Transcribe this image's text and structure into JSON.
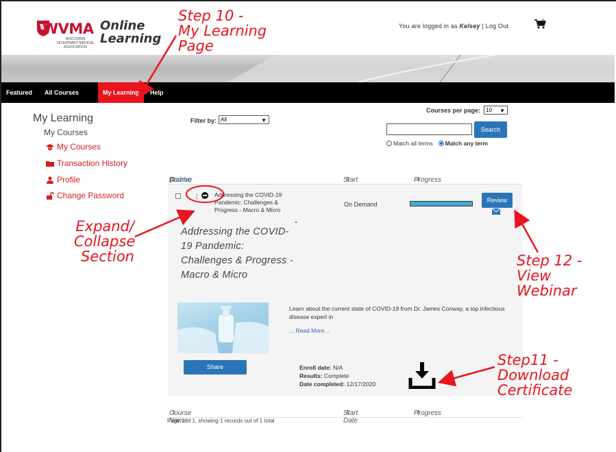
{
  "header": {
    "logo_text": "WVMA",
    "logo_subtext": "WISCONSIN VETERINARY MEDICAL ASSOCIATION",
    "logo_online": "Online",
    "logo_learning": "Learning",
    "login_prefix": "You are logged in as ",
    "username": "Kelsey",
    "logout": " | Log Out",
    "cart_count": "0"
  },
  "nav": {
    "items": [
      {
        "label": "Featured",
        "active": false
      },
      {
        "label": "All Courses",
        "active": false
      },
      {
        "label": "My Learning",
        "active": true
      },
      {
        "label": "Help",
        "active": false
      }
    ]
  },
  "sidebar": {
    "title": "My Learning",
    "subtitle": "My Courses",
    "links": [
      {
        "label": "My Courses",
        "icon": "graduation-cap-icon"
      },
      {
        "label": "Transaction History",
        "icon": "folder-icon"
      },
      {
        "label": "Profile",
        "icon": "user-icon"
      },
      {
        "label": "Change Password",
        "icon": "unlock-icon"
      }
    ]
  },
  "filters": {
    "filter_label": "Filter by:",
    "filter_value": "All",
    "per_page_label": "Courses per page:",
    "per_page_value": "10",
    "search_value": "",
    "search_button": "Search",
    "match_all": "Match all terms",
    "match_any": "Match any term",
    "selected_match": "any"
  },
  "table": {
    "header": {
      "archive": "Archive",
      "separator": " | ",
      "course_name": "Course Name",
      "start_date": "Start Date",
      "progress": "Progress"
    },
    "row": {
      "title_short": "Addressing the COVID-19 Pandemic: Challenges & Progress - Macro & Micro",
      "start": "On Demand",
      "progress": 1.0,
      "review_button": "Review",
      "title_long": "Addressing the COVID-19 Pandemic: Challenges & Progress - Macro & Micro",
      "description": "Learn about the current state of COVID-19 from Dr. James Conway, a top infectious disease expert in",
      "read_more": "... Read More...",
      "share_button": "Share",
      "enroll_label": "Enroll date:",
      "enroll_value": "N/A",
      "results_label": "Results:",
      "results_value": "Complete",
      "completed_label": "Date completed:",
      "completed_value": "12/17/2020"
    },
    "footer_header": {
      "course_name": "Course Name",
      "start_date": "Start Date",
      "progress": "Progress"
    },
    "paging": "Page 1 of 1, showing 1 records out of 1 total"
  },
  "annotations": {
    "step10_line1": "Step 10 -",
    "step10_line2": "My Learning",
    "step10_line3": "Page",
    "expand_line1": "Expand/",
    "expand_line2": "Collapse",
    "expand_line3": "Section",
    "step12_line1": "Step 12 -",
    "step12_line2": "View",
    "step12_line3": "Webinar",
    "step11_line1": "Step11 -",
    "step11_line2": "Download",
    "step11_line3": "Certificate"
  },
  "colors": {
    "brand_red": "#e8141e",
    "button_blue": "#2b74b8",
    "progress_blue": "#4aa8d8"
  }
}
